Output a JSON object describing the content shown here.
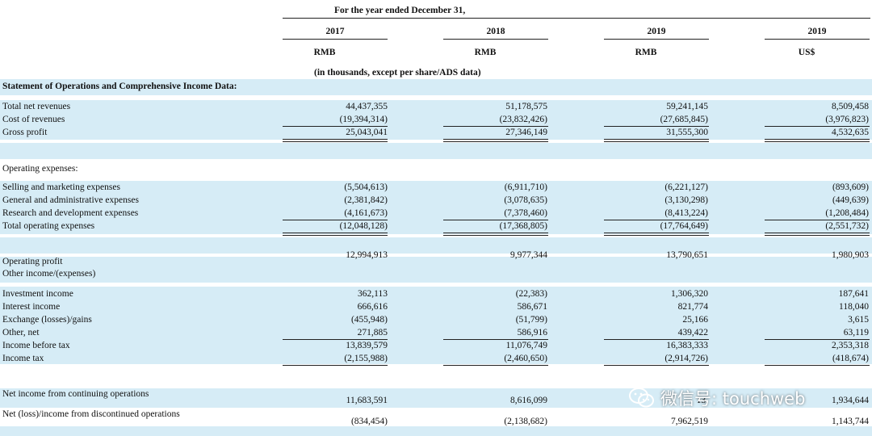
{
  "header": {
    "period": "For the year ended December 31,",
    "years": [
      "2017",
      "2018",
      "2019",
      "2019"
    ],
    "currencies": [
      "RMB",
      "RMB",
      "RMB",
      "US$"
    ],
    "unit_note": "(in thousands, except per share/ADS data)"
  },
  "section_title": "Statement of Operations and Comprehensive Income Data:",
  "rows": {
    "total_net_revenues": {
      "label": "Total net revenues",
      "values": [
        "44,437,355",
        "51,178,575",
        "59,241,145",
        "8,509,458"
      ]
    },
    "cost_of_revenues": {
      "label": "Cost of revenues",
      "values": [
        "(19,394,314)",
        "(23,832,426)",
        "(27,685,845)",
        "(3,976,823)"
      ]
    },
    "gross_profit": {
      "label": "Gross profit",
      "values": [
        "25,043,041",
        "27,346,149",
        "31,555,300",
        "4,532,635"
      ]
    },
    "operating_expenses": {
      "label": "Operating expenses:"
    },
    "selling_marketing": {
      "label": "Selling and marketing expenses",
      "values": [
        "(5,504,613)",
        "(6,911,710)",
        "(6,221,127)",
        "(893,609)"
      ]
    },
    "general_admin": {
      "label": "General and administrative expenses",
      "values": [
        "(2,381,842)",
        "(3,078,635)",
        "(3,130,298)",
        "(449,639)"
      ]
    },
    "research_dev": {
      "label": "Research and development expenses",
      "values": [
        "(4,161,673)",
        "(7,378,460)",
        "(8,413,224)",
        "(1,208,484)"
      ]
    },
    "total_operating": {
      "label": "Total operating expenses",
      "values": [
        "(12,048,128)",
        "(17,368,805)",
        "(17,764,649)",
        "(2,551,732)"
      ]
    },
    "operating_profit": {
      "label": "Operating profit",
      "values": [
        "12,994,913",
        "9,977,344",
        "13,790,651",
        "1,980,903"
      ]
    },
    "other_income": {
      "label": "Other income/(expenses)"
    },
    "investment_income": {
      "label": "Investment income",
      "values": [
        "362,113",
        "(22,383)",
        "1,306,320",
        "187,641"
      ]
    },
    "interest_income": {
      "label": "Interest income",
      "values": [
        "666,616",
        "586,671",
        "821,774",
        "118,040"
      ]
    },
    "exchange": {
      "label": "Exchange (losses)/gains",
      "values": [
        "(455,948)",
        "(51,799)",
        "25,166",
        "3,615"
      ]
    },
    "other_net": {
      "label": "Other, net",
      "values": [
        "271,885",
        "586,916",
        "439,422",
        "63,119"
      ]
    },
    "income_before_tax": {
      "label": "Income before tax",
      "values": [
        "13,839,579",
        "11,076,749",
        "16,383,333",
        "2,353,318"
      ]
    },
    "income_tax": {
      "label": "Income tax",
      "values": [
        "(2,155,988)",
        "(2,460,650)",
        "(2,914,726)",
        "(418,674)"
      ]
    },
    "net_income_continuing": {
      "label": "Net income from continuing operations",
      "values": [
        "11,683,591",
        "8,616,099",
        "13,",
        "1,934,644"
      ]
    },
    "net_income_discontinued": {
      "label": "Net (loss)/income from discontinued operations",
      "values": [
        "(834,454)",
        "(2,138,682)",
        "7,962,519",
        "1,143,744"
      ]
    }
  },
  "watermark": {
    "text": "微信号: touchweb",
    "icon": "wechat-icon"
  }
}
